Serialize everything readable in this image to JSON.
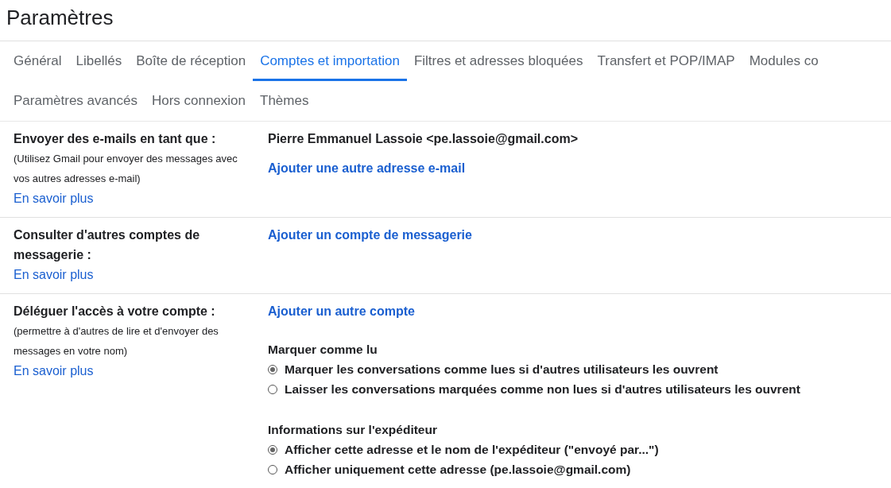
{
  "title": "Paramètres",
  "tab_rows": [
    [
      {
        "label": "Général",
        "selected": false
      },
      {
        "label": "Libellés",
        "selected": false
      },
      {
        "label": "Boîte de réception",
        "selected": false
      },
      {
        "label": "Comptes et importation",
        "selected": true
      },
      {
        "label": "Filtres et adresses bloquées",
        "selected": false
      },
      {
        "label": "Transfert et POP/IMAP",
        "selected": false
      },
      {
        "label": "Modules co",
        "selected": false
      }
    ],
    [
      {
        "label": "Paramètres avancés",
        "selected": false
      },
      {
        "label": "Hors connexion",
        "selected": false
      },
      {
        "label": "Thèmes",
        "selected": false
      }
    ]
  ],
  "sections": [
    {
      "label": "Envoyer des e-mails en tant que :",
      "description": "(Utilisez Gmail pour envoyer des messages avec vos autres adresses e-mail)",
      "learn_more": "En savoir plus",
      "content": [
        {
          "kind": "text",
          "text": "Pierre Emmanuel Lassoie <pe.lassoie@gmail.com>"
        },
        {
          "kind": "link",
          "text": "Ajouter une autre adresse e-mail"
        }
      ]
    },
    {
      "label": "Consulter d'autres comptes de messagerie :",
      "learn_more": "En savoir plus",
      "content": [
        {
          "kind": "link",
          "text": "Ajouter un compte de messagerie"
        }
      ]
    },
    {
      "label": "Déléguer l'accès à votre compte :",
      "description": "(permettre à d'autres de lire et d'envoyer des messages en votre nom)",
      "learn_more": "En savoir plus",
      "content": [
        {
          "kind": "link",
          "text": "Ajouter un autre compte"
        },
        {
          "kind": "radio_group",
          "heading": "Marquer comme lu",
          "options": [
            {
              "label": "Marquer les conversations comme lues si d'autres utilisateurs les ouvrent",
              "selected": true
            },
            {
              "label": "Laisser les conversations marquées comme non lues si d'autres utilisateurs les ouvrent",
              "selected": false
            }
          ]
        },
        {
          "kind": "radio_group",
          "heading": "Informations sur l'expéditeur",
          "options": [
            {
              "label": "Afficher cette adresse et le nom de l'expéditeur (\"envoyé par...\")",
              "selected": true
            },
            {
              "label": "Afficher uniquement cette adresse (pe.lassoie@gmail.com)",
              "selected": false
            }
          ]
        }
      ]
    }
  ]
}
